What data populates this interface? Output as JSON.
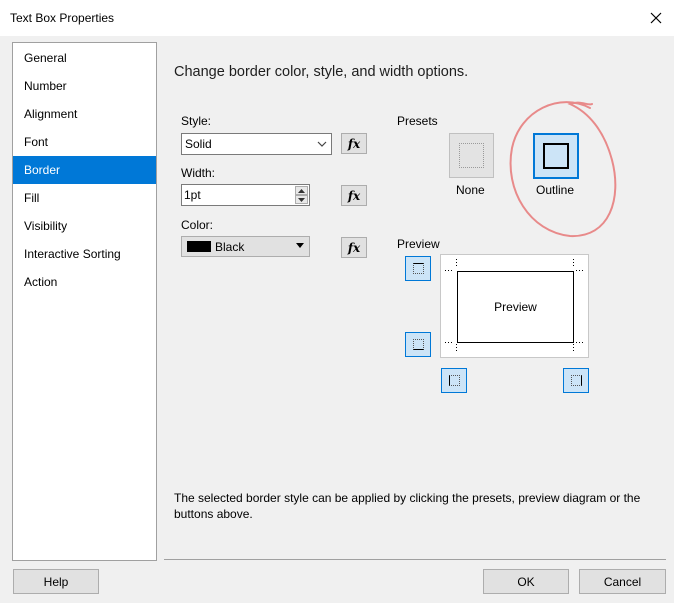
{
  "window": {
    "title": "Text Box Properties"
  },
  "nav": {
    "items": [
      {
        "label": "General"
      },
      {
        "label": "Number"
      },
      {
        "label": "Alignment"
      },
      {
        "label": "Font"
      },
      {
        "label": "Border",
        "selected": true
      },
      {
        "label": "Fill"
      },
      {
        "label": "Visibility"
      },
      {
        "label": "Interactive Sorting"
      },
      {
        "label": "Action"
      }
    ]
  },
  "main": {
    "heading": "Change border color, style, and width options.",
    "style": {
      "label": "Style:",
      "value": "Solid"
    },
    "width": {
      "label": "Width:",
      "value": "1pt"
    },
    "color": {
      "label": "Color:",
      "value": "Black",
      "swatch": "#000000"
    },
    "fx_label": "fx",
    "presets": {
      "label": "Presets",
      "none_label": "None",
      "outline_label": "Outline"
    },
    "preview": {
      "label": "Preview",
      "text": "Preview"
    },
    "hint": "The selected border style can be applied by clicking the presets, preview diagram or the buttons above."
  },
  "footer": {
    "help": "Help",
    "ok": "OK",
    "cancel": "Cancel"
  },
  "colors": {
    "accent": "#0078d7",
    "selected_bg": "#cce4f7",
    "annotation": "#e88a8a"
  },
  "annotation": {
    "type": "hand-drawn circle around Outline preset"
  }
}
